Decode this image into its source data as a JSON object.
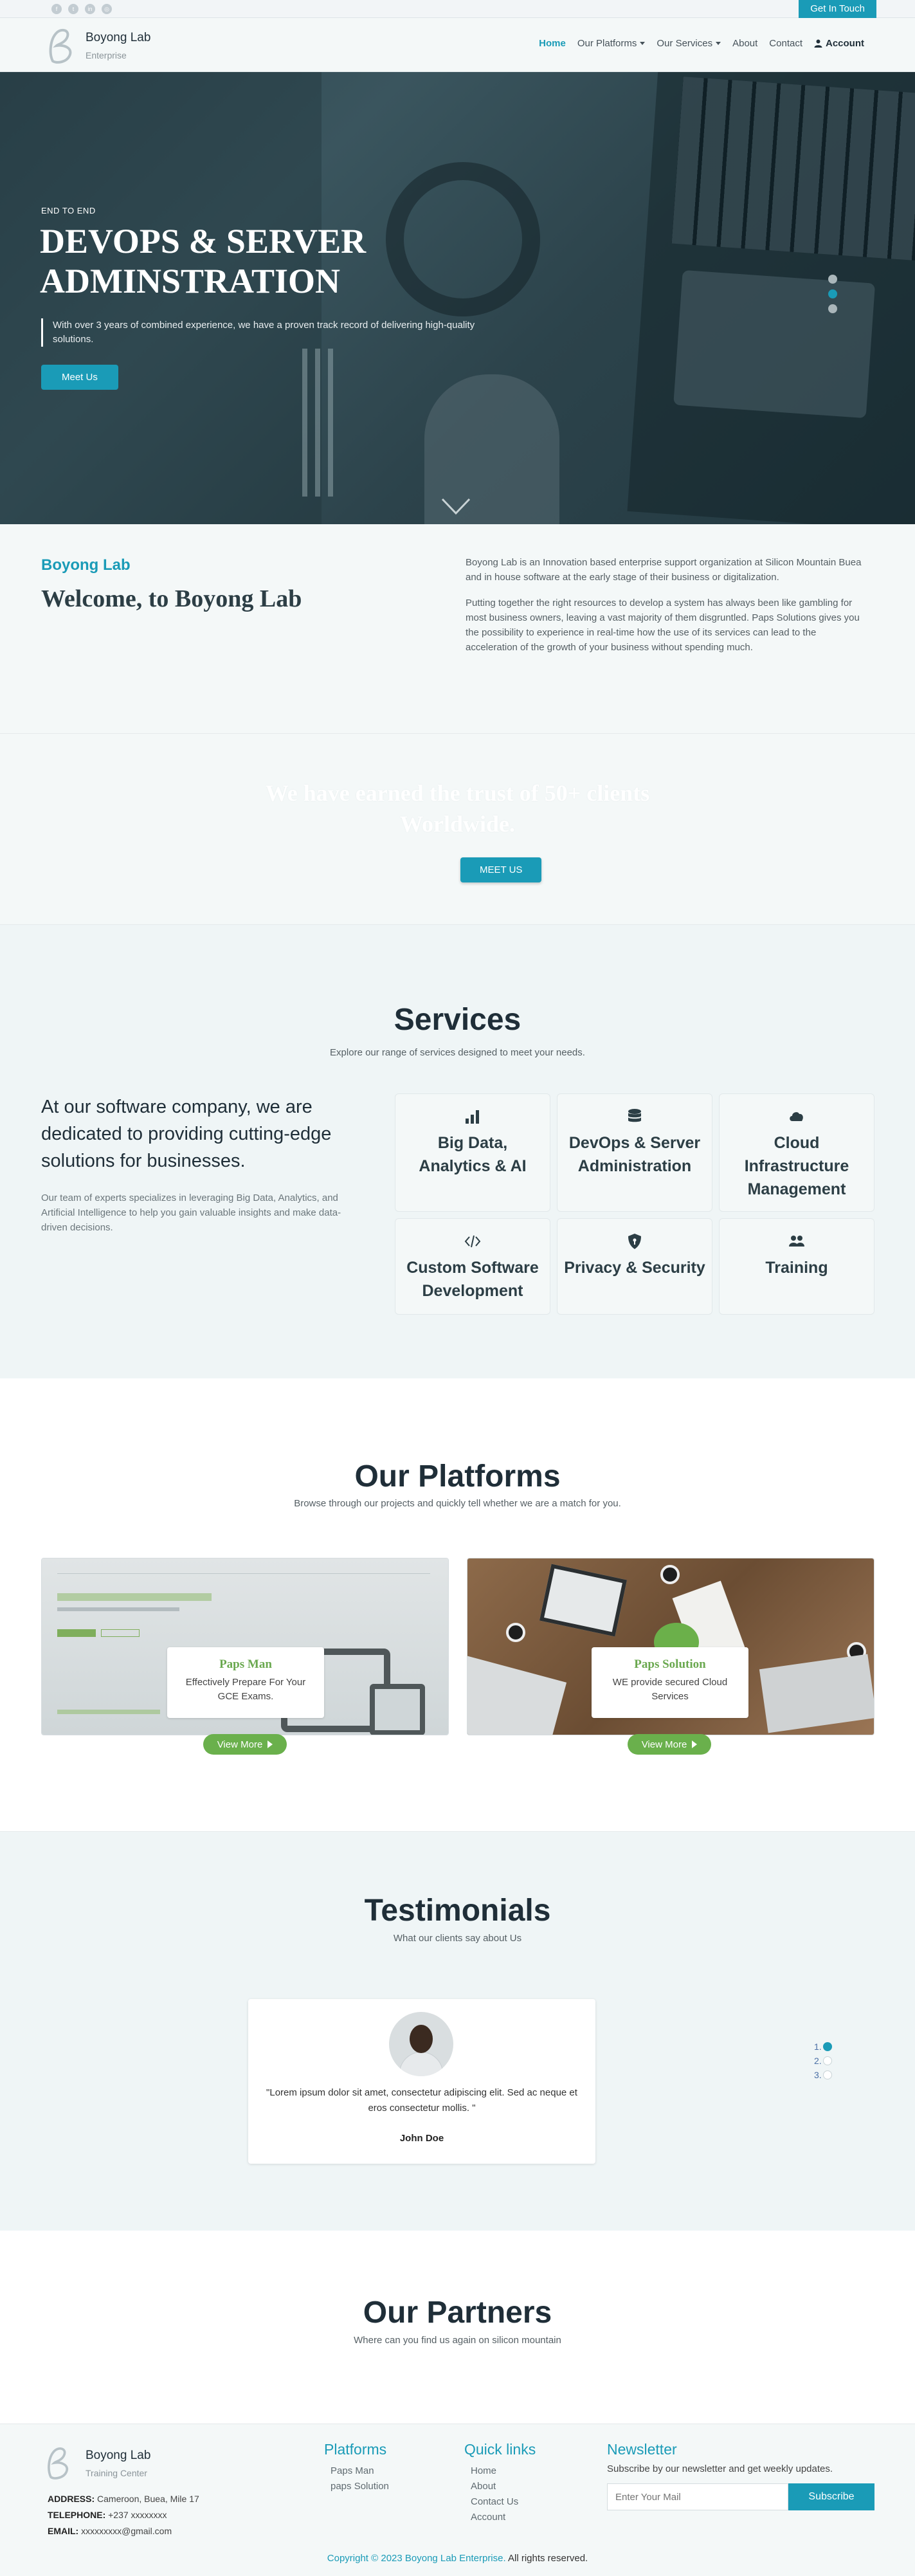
{
  "topbar": {
    "social_icons": [
      "facebook-icon",
      "twitter-icon",
      "linkedin-icon",
      "instagram-icon"
    ],
    "get_in_touch": "Get In Touch"
  },
  "header": {
    "brand_name": "Boyong Lab",
    "brand_sub": "Enterprise",
    "nav": {
      "home": "Home",
      "platforms": "Our Platforms",
      "services": "Our Services",
      "about": "About",
      "contact": "Contact",
      "account": "Account"
    }
  },
  "hero": {
    "tag": "END TO END",
    "title": "DEVOPS & SERVER ADMINSTRATION",
    "desc": "With over 3 years of combined experience, we have a proven track record of delivering high-quality solutions.",
    "button": "Meet Us"
  },
  "welcome": {
    "label": "Boyong Lab",
    "title": "Welcome, to Boyong Lab",
    "p1": "Boyong Lab is an Innovation based enterprise support organization at Silicon Mountain Buea and in house software at the early stage of their business or digitalization.",
    "p2": "Putting together the right resources to develop a system has always been like gambling for most business owners, leaving a vast majority of them disgruntled. Paps Solutions gives you the possibility to experience in real-time how the use of its services can lead to the acceleration of the growth of your business without spending much."
  },
  "trust": {
    "title": "We have earned the trust of 50+ clients Worldwide.",
    "button": "MEET US"
  },
  "services": {
    "title": "Services",
    "subtitle": "Explore our range of services designed to meet your needs.",
    "lead": "At our software company, we are dedicated to providing cutting-edge solutions for businesses.",
    "text": "Our team of experts specializes in leveraging Big Data, Analytics, and Artificial Intelligence to help you gain valuable insights and make data-driven decisions.",
    "items": [
      {
        "label": "Big Data, Analytics & AI",
        "icon": "chart-bar-icon"
      },
      {
        "label": "DevOps & Server Administration",
        "icon": "database-icon"
      },
      {
        "label": "Cloud Infrastructure Management",
        "icon": "cloud-icon"
      },
      {
        "label": "Custom Software Development",
        "icon": "code-icon"
      },
      {
        "label": "Privacy & Security",
        "icon": "shield-icon"
      },
      {
        "label": "Training",
        "icon": "users-icon"
      }
    ]
  },
  "platforms": {
    "title": "Our Platforms",
    "subtitle": "Browse through our projects and quickly tell whether we are a match for you.",
    "items": [
      {
        "name": "Paps Man",
        "desc": "Effectively Prepare For Your GCE Exams.",
        "button": "View More"
      },
      {
        "name": "Paps Solution",
        "desc": "WE provide secured Cloud Services",
        "button": "View More"
      }
    ]
  },
  "testimonials": {
    "title": "Testimonials",
    "subtitle": "What our clients say about Us",
    "quote": "\"Lorem ipsum dolor sit amet, consectetur adipiscing elit. Sed ac neque et eros consectetur mollis. \"",
    "author": "John Doe",
    "indicators": [
      "1.",
      "2.",
      "3."
    ]
  },
  "partners": {
    "title": "Our Partners",
    "subtitle": "Where can you find us again on silicon mountain"
  },
  "footer": {
    "brand_name": "Boyong Lab",
    "brand_sub": "Training Center",
    "address_label": "ADDRESS:",
    "address": "Cameroon, Buea, Mile 17",
    "phone_label": "TELEPHONE:",
    "phone": "+237 xxxxxxxx",
    "email_label": "EMAIL:",
    "email": "xxxxxxxxx@gmail.com",
    "platforms_title": "Platforms",
    "platform_links": [
      "Paps Man",
      "paps Solution"
    ],
    "quick_title": "Quick links",
    "quick_links": [
      "Home",
      "About",
      "Contact Us",
      "Account"
    ],
    "newsletter_title": "Newsletter",
    "newsletter_text": "Subscribe by our newsletter and get weekly updates.",
    "email_placeholder": "Enter Your Mail",
    "subscribe": "Subscribe",
    "copyright_link": "Copyright © 2023 Boyong Lab Enterprise.",
    "copyright_rest": " All rights reserved."
  },
  "colors": {
    "accent": "#1a9bb7",
    "green": "#6ab04c",
    "dark": "#1f2e38"
  }
}
